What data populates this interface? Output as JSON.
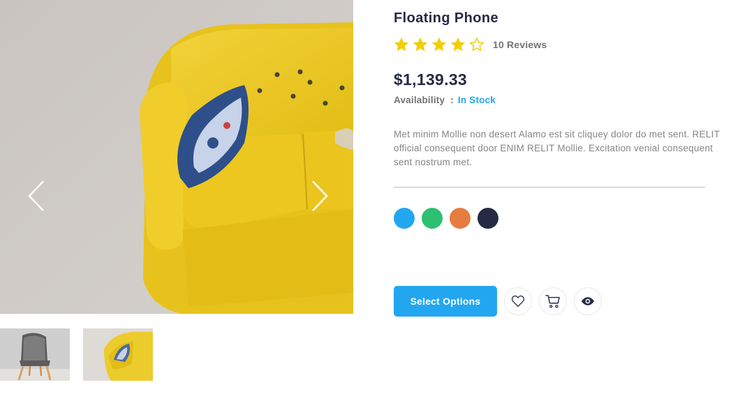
{
  "product": {
    "title": "Floating Phone",
    "rating": 4,
    "max_rating": 5,
    "reviews_label": "10 Reviews",
    "price": "$1,139.33",
    "availability_label": "Availability",
    "availability_separator": ":",
    "availability_status": "In Stock",
    "description": "Met minim Mollie non desert Alamo est sit cliquey dolor do met sent. RELIT official consequent door ENIM RELIT Mollie. Excitation venial consequent sent nostrum met."
  },
  "colors": {
    "accent": "#23a6f0",
    "star": "#f3cd03",
    "swatches": [
      "#23a6f0",
      "#2dc071",
      "#e77c40",
      "#252b42"
    ]
  },
  "actions": {
    "select_options_label": "Select Options",
    "icons": [
      "heart-icon",
      "cart-icon",
      "eye-icon"
    ]
  },
  "gallery": {
    "main_image": "yellow-sofa-photo",
    "thumbnails": [
      "patterned-chair-photo",
      "yellow-sofa-photo"
    ]
  }
}
